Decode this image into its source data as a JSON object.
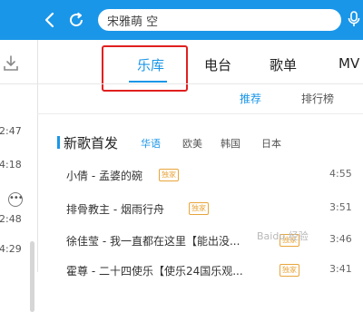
{
  "colors": {
    "accent": "#1a96e8",
    "badge": "#e8a53a",
    "highlight_box": "#e02020"
  },
  "toolbar": {
    "back_icon": "chevron-left-icon",
    "refresh_icon": "refresh-icon",
    "mic_icon": "microphone-icon"
  },
  "search": {
    "value": "宋雅萌 空"
  },
  "sidebar": {
    "download_icon": "download-icon",
    "times": [
      "02:47",
      "04:18",
      "02:48",
      "04:29"
    ],
    "more_icon": "ellipsis-icon"
  },
  "tabs": [
    {
      "label": "乐库",
      "active": true
    },
    {
      "label": "电台",
      "active": false
    },
    {
      "label": "歌单",
      "active": false
    },
    {
      "label": "MV",
      "active": false
    }
  ],
  "subtabs": [
    {
      "label": "推荐",
      "active": true
    },
    {
      "label": "排行榜",
      "active": false
    }
  ],
  "section": {
    "title": "新歌首发",
    "filters": [
      {
        "label": "华语",
        "active": true
      },
      {
        "label": "欧美",
        "active": false
      },
      {
        "label": "韩国",
        "active": false
      },
      {
        "label": "日本",
        "active": false
      }
    ]
  },
  "songs": [
    {
      "title": "小倩 - 孟婆的碗",
      "badge": "独家",
      "duration": "4:55"
    },
    {
      "title": "排骨教主 - 烟雨行舟",
      "badge": "独家",
      "duration": "3:51"
    },
    {
      "title": "徐佳莹 - 我一直都在这里【能出没...",
      "badge": "独家",
      "duration": "3:46"
    },
    {
      "title": "霍尊 - 二十四使乐【使乐24国乐观...",
      "badge": "独家",
      "duration": "3:41"
    }
  ],
  "watermark": "Baidu 经验"
}
